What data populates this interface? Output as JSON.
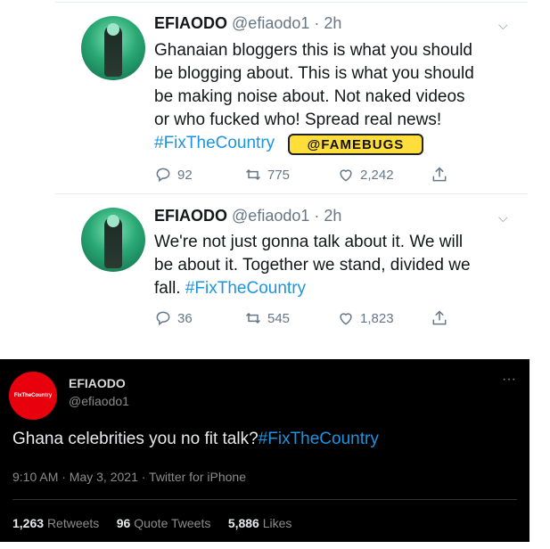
{
  "tweet1": {
    "name": "EFIAODO",
    "handle": "@efiaodo1 · 2h",
    "lines": [
      "Ghanaian bloggers this is what you should",
      "be blogging about. This is what you should",
      "be making noise about. Not naked videos",
      "or who fucked who! Spread real news!"
    ],
    "hashtag": "#FixTheCountry",
    "watermark": "@FAMEBUGS",
    "replies": "92",
    "retweets": "775",
    "likes": "2,242"
  },
  "tweet2": {
    "name": "EFIAODO",
    "handle": "@efiaodo1 · 2h",
    "lines": [
      "We're not just gonna talk about it. We will",
      "be about it. Together we stand, divided we"
    ],
    "line3_prefix": "fall. ",
    "hashtag": "#FixTheCountry",
    "replies": "36",
    "retweets": "545",
    "likes": "1,823"
  },
  "tweet3": {
    "name": "EFIAODO",
    "handle": "@efiaodo1",
    "avatar_text": "FixTheCountry",
    "more": "···",
    "text": "Ghana celebrities you no fit talk?",
    "hashtag": "#FixTheCountry",
    "meta": "9:10 AM · May 3, 2021 · Twitter for iPhone",
    "retweets_count": "1,263",
    "retweets_label": "Retweets",
    "quotes_count": "96",
    "quotes_label": "Quote Tweets",
    "likes_count": "5,886",
    "likes_label": "Likes"
  },
  "colors": {
    "link": "#1b95e0",
    "dark_bg": "#000000",
    "avatar_red": "#e8000c"
  }
}
